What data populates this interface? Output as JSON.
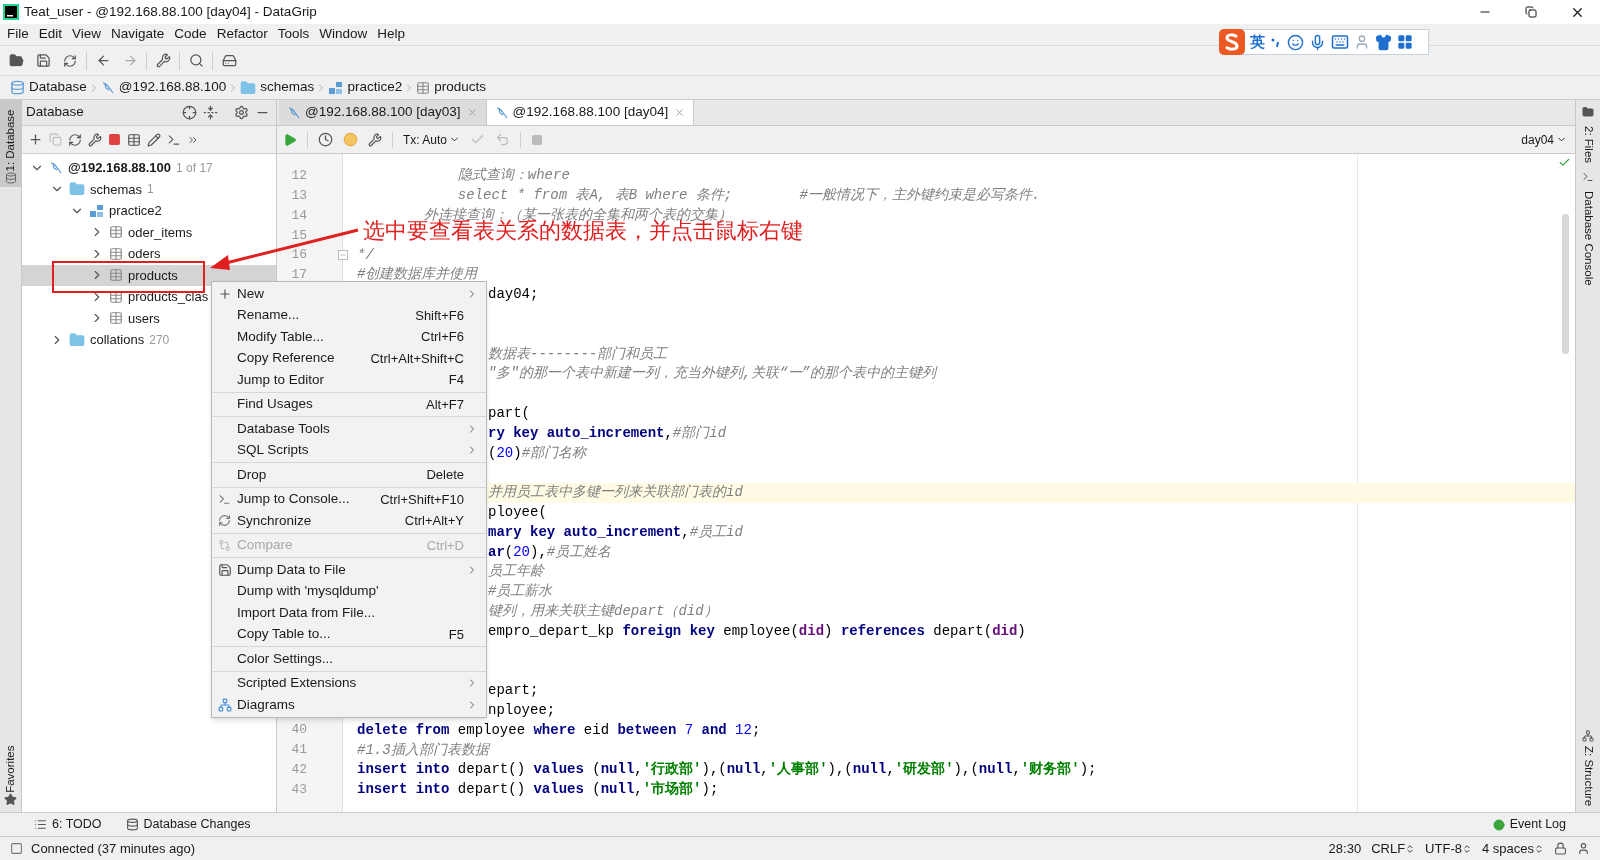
{
  "window": {
    "title": "Teat_user - @192.168.88.100 [day04] - DataGrip"
  },
  "menu_bar": [
    "File",
    "Edit",
    "View",
    "Navigate",
    "Code",
    "Refactor",
    "Tools",
    "Window",
    "Help"
  ],
  "ime_toolbar": {
    "mode": "英"
  },
  "breadcrumb": [
    {
      "label": "Database",
      "kind": "database"
    },
    {
      "label": "@192.168.88.100",
      "kind": "connection"
    },
    {
      "label": "schemas",
      "kind": "folder"
    },
    {
      "label": "practice2",
      "kind": "schema"
    },
    {
      "label": "products",
      "kind": "table"
    }
  ],
  "database_panel": {
    "title": "Database",
    "tree": [
      {
        "label": "@192.168.88.100",
        "count": "1 of 17",
        "kind": "connection",
        "expanded": true,
        "selected": false,
        "children": [
          {
            "label": "schemas",
            "count": "1",
            "kind": "folder",
            "expanded": true,
            "selected": false,
            "children": [
              {
                "label": "practice2",
                "kind": "schema",
                "expanded": true,
                "selected": false,
                "children": [
                  {
                    "label": "oder_items",
                    "kind": "table",
                    "expanded": false,
                    "selected": false
                  },
                  {
                    "label": "oders",
                    "kind": "table",
                    "expanded": false,
                    "selected": false
                  },
                  {
                    "label": "products",
                    "kind": "table",
                    "expanded": false,
                    "selected": true
                  },
                  {
                    "label": "products_clas",
                    "kind": "table",
                    "expanded": false,
                    "selected": false
                  },
                  {
                    "label": "users",
                    "kind": "table",
                    "expanded": false,
                    "selected": false
                  }
                ]
              }
            ]
          },
          {
            "label": "collations",
            "count": "270",
            "kind": "folder",
            "expanded": false,
            "selected": false
          }
        ]
      }
    ]
  },
  "editor_tabs": [
    {
      "label": "@192.168.88.100 [day03]",
      "selected": false
    },
    {
      "label": "@192.168.88.100 [day04]",
      "selected": true
    }
  ],
  "editor_toolbar": {
    "transaction": "Tx: Auto",
    "schema": "day04"
  },
  "code_lines": [
    {
      "number": "12",
      "tokens": [
        {
          "kind": "comment",
          "text": "            隐式查询：where"
        }
      ]
    },
    {
      "number": "13",
      "tokens": [
        {
          "kind": "comment",
          "text": "            select * from 表A, 表B where 条件;        #一般情况下，主外键约束是必写条件."
        }
      ]
    },
    {
      "number": "14",
      "tokens": [
        {
          "kind": "comment",
          "text": "        外连接查询：（某一张表的全集和两个表的交集）"
        }
      ]
    },
    {
      "number": "15"
    },
    {
      "number": "16",
      "fold": true,
      "tokens": [
        {
          "kind": "comment",
          "text": "*/"
        }
      ]
    },
    {
      "number": "17",
      "tokens": [
        {
          "kind": "comment",
          "text": "#创建数据库并使用"
        }
      ]
    },
    {
      "covered": true,
      "tokens": [
        {
          "kind": "plain",
          "text": "day04;"
        }
      ]
    },
    {
      "covered": true
    },
    {
      "covered": true
    },
    {
      "covered": true,
      "tokens": [
        {
          "kind": "comment",
          "text": "数据表--------部门和员工"
        }
      ]
    },
    {
      "covered": true,
      "tokens": [
        {
          "kind": "comment",
          "text": "\"多\"的那一个表中新建一列，充当外键列,关联“一”的那个表中的主键列"
        }
      ]
    },
    {
      "covered": true
    },
    {
      "covered": true,
      "tokens": [
        {
          "kind": "plain",
          "text": "part("
        }
      ]
    },
    {
      "covered": true,
      "tokens": [
        {
          "kind": "kw",
          "text": "ry key auto_increment"
        },
        {
          "kind": "plain",
          "text": ","
        },
        {
          "kind": "comment",
          "text": "#部门id"
        }
      ]
    },
    {
      "covered": true,
      "tokens": [
        {
          "kind": "plain",
          "text": "("
        },
        {
          "kind": "num",
          "text": "20"
        },
        {
          "kind": "plain",
          "text": ")"
        },
        {
          "kind": "comment",
          "text": "#部门名称"
        }
      ]
    },
    {
      "covered": true
    },
    {
      "covered": true,
      "current": true,
      "tokens": [
        {
          "kind": "comment",
          "text": "并用员工表中多键一列来关联部门表的id"
        }
      ]
    },
    {
      "covered": true,
      "tokens": [
        {
          "kind": "plain",
          "text": "ployee("
        }
      ]
    },
    {
      "covered": true,
      "tokens": [
        {
          "kind": "kw",
          "text": "mary key auto_increment"
        },
        {
          "kind": "plain",
          "text": ","
        },
        {
          "kind": "comment",
          "text": "#员工id"
        }
      ]
    },
    {
      "covered": true,
      "tokens": [
        {
          "kind": "kw",
          "text": "ar"
        },
        {
          "kind": "plain",
          "text": "("
        },
        {
          "kind": "num",
          "text": "20"
        },
        {
          "kind": "plain",
          "text": "),"
        },
        {
          "kind": "comment",
          "text": "#员工姓名"
        }
      ]
    },
    {
      "covered": true,
      "tokens": [
        {
          "kind": "comment",
          "text": "员工年龄"
        }
      ]
    },
    {
      "covered": true,
      "tokens": [
        {
          "kind": "comment",
          "text": "#员工薪水"
        }
      ]
    },
    {
      "covered": true,
      "tokens": [
        {
          "kind": "comment",
          "text": "键列，用来关联主键depart（did）"
        }
      ]
    },
    {
      "covered": true,
      "tokens": [
        {
          "kind": "plain",
          "text": "empro_depart_kp "
        },
        {
          "kind": "kw",
          "text": "foreign key"
        },
        {
          "kind": "plain",
          "text": " employee("
        },
        {
          "kind": "field",
          "text": "did"
        },
        {
          "kind": "plain",
          "text": ") "
        },
        {
          "kind": "kw",
          "text": "references"
        },
        {
          "kind": "plain",
          "text": " depart("
        },
        {
          "kind": "field",
          "text": "did"
        },
        {
          "kind": "plain",
          "text": ")"
        }
      ]
    },
    {
      "covered": true
    },
    {
      "covered": true
    },
    {
      "covered": true,
      "tokens": [
        {
          "kind": "plain",
          "text": "epart;"
        }
      ]
    },
    {
      "covered": true,
      "tokens": [
        {
          "kind": "plain",
          "text": "nployee;"
        }
      ]
    },
    {
      "number": "40",
      "tokens": [
        {
          "kind": "kw",
          "text": "delete from"
        },
        {
          "kind": "plain",
          "text": " employee "
        },
        {
          "kind": "kw",
          "text": "where"
        },
        {
          "kind": "plain",
          "text": " eid "
        },
        {
          "kind": "kw",
          "text": "between"
        },
        {
          "kind": "num",
          "text": " 7 "
        },
        {
          "kind": "kw",
          "text": "and"
        },
        {
          "kind": "num",
          "text": " 12"
        },
        {
          "kind": "plain",
          "text": ";"
        }
      ]
    },
    {
      "number": "41",
      "tokens": [
        {
          "kind": "comment",
          "text": "#1.3插入部门表数据"
        }
      ]
    },
    {
      "number": "42",
      "tokens": [
        {
          "kind": "kw",
          "text": "insert into"
        },
        {
          "kind": "plain",
          "text": " depart() "
        },
        {
          "kind": "kw",
          "text": "values"
        },
        {
          "kind": "plain",
          "text": " ("
        },
        {
          "kind": "kw",
          "text": "null"
        },
        {
          "kind": "plain",
          "text": ","
        },
        {
          "kind": "str",
          "text": "'行政部'"
        },
        {
          "kind": "plain",
          "text": "),("
        },
        {
          "kind": "kw",
          "text": "null"
        },
        {
          "kind": "plain",
          "text": ","
        },
        {
          "kind": "str",
          "text": "'人事部'"
        },
        {
          "kind": "plain",
          "text": "),("
        },
        {
          "kind": "kw",
          "text": "null"
        },
        {
          "kind": "plain",
          "text": ","
        },
        {
          "kind": "str",
          "text": "'研发部'"
        },
        {
          "kind": "plain",
          "text": "),("
        },
        {
          "kind": "kw",
          "text": "null"
        },
        {
          "kind": "plain",
          "text": ","
        },
        {
          "kind": "str",
          "text": "'财务部'"
        },
        {
          "kind": "plain",
          "text": ");"
        }
      ]
    },
    {
      "number": "43",
      "tokens": [
        {
          "kind": "kw",
          "text": "insert into"
        },
        {
          "kind": "plain",
          "text": " depart() "
        },
        {
          "kind": "kw",
          "text": "values"
        },
        {
          "kind": "plain",
          "text": " ("
        },
        {
          "kind": "kw",
          "text": "null"
        },
        {
          "kind": "plain",
          "text": ","
        },
        {
          "kind": "str",
          "text": "'市场部'"
        },
        {
          "kind": "plain",
          "text": ");"
        }
      ]
    }
  ],
  "context_menu": {
    "groups": [
      [
        {
          "label": "New",
          "submenu": true,
          "disabled": false
        },
        {
          "label": "Rename...",
          "shortcut": "Shift+F6",
          "submenu": false,
          "disabled": false
        },
        {
          "label": "Modify Table...",
          "shortcut": "Ctrl+F6",
          "submenu": false,
          "disabled": false
        },
        {
          "label": "Copy Reference",
          "shortcut": "Ctrl+Alt+Shift+C",
          "submenu": false,
          "disabled": false
        },
        {
          "label": "Jump to Editor",
          "shortcut": "F4",
          "submenu": false,
          "disabled": false
        }
      ],
      [
        {
          "label": "Find Usages",
          "shortcut": "Alt+F7",
          "submenu": false,
          "disabled": false
        }
      ],
      [
        {
          "label": "Database Tools",
          "submenu": true,
          "disabled": false
        },
        {
          "label": "SQL Scripts",
          "submenu": true,
          "disabled": false
        }
      ],
      [
        {
          "label": "Drop",
          "shortcut": "Delete",
          "submenu": false,
          "disabled": false
        }
      ],
      [
        {
          "label": "Jump to Console...",
          "shortcut": "Ctrl+Shift+F10",
          "submenu": false,
          "disabled": false
        },
        {
          "label": "Synchronize",
          "shortcut": "Ctrl+Alt+Y",
          "submenu": false,
          "disabled": false
        }
      ],
      [
        {
          "label": "Compare",
          "shortcut": "Ctrl+D",
          "submenu": false,
          "disabled": true
        }
      ],
      [
        {
          "label": "Dump Data to File",
          "submenu": true,
          "disabled": false
        },
        {
          "label": "Dump with 'mysqldump'",
          "submenu": false,
          "disabled": false
        },
        {
          "label": "Import Data from File...",
          "submenu": false,
          "disabled": false
        },
        {
          "label": "Copy Table to...",
          "shortcut": "F5",
          "submenu": false,
          "disabled": false
        }
      ],
      [
        {
          "label": "Color Settings...",
          "submenu": false,
          "disabled": false
        }
      ],
      [
        {
          "label": "Scripted Extensions",
          "submenu": true,
          "disabled": false
        },
        {
          "label": "Diagrams",
          "submenu": true,
          "disabled": false
        }
      ]
    ]
  },
  "annotation": {
    "text": "选中要查看表关系的数据表，并点击鼠标右键"
  },
  "left_strip": [
    "1: Database",
    "Favorites"
  ],
  "right_strip": [
    "2: Files",
    "Database Console",
    "Z: Structure"
  ],
  "tool_windows": [
    "6: TODO",
    "Database Changes",
    "Event Log"
  ],
  "status_bar": {
    "message": "Connected (37 minutes ago)",
    "position": "28:30",
    "line_separator": "CRLF",
    "encoding": "UTF-8",
    "indent": "4 spaces"
  }
}
